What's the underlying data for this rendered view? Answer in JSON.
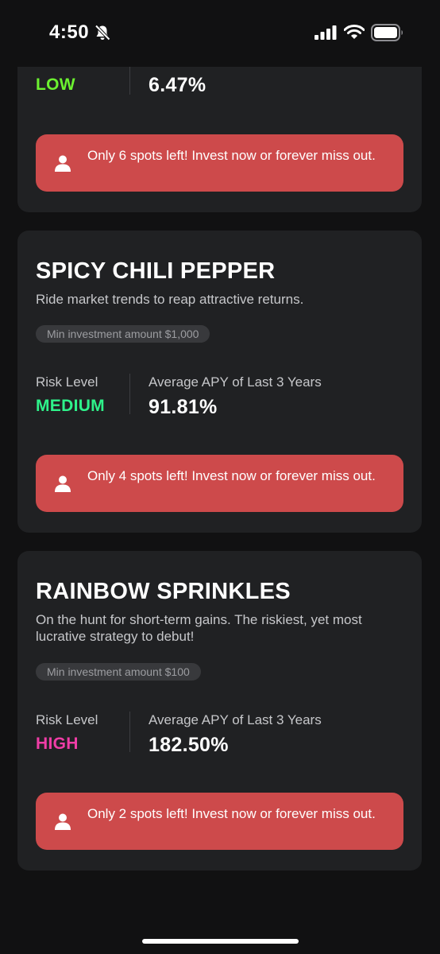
{
  "status_bar": {
    "time": "4:50"
  },
  "cards": [
    {
      "risk_value": "LOW",
      "risk_color": "#6cf230",
      "apy_value": "6.47%",
      "spots_text": "Only 6 spots left! Invest now or forever miss out."
    },
    {
      "title": "SPICY CHILI PEPPER",
      "description": "Ride market trends to reap attractive returns.",
      "min_investment": "Min investment amount $1,000",
      "risk_label": "Risk Level",
      "risk_value": "MEDIUM",
      "risk_color": "#2ef28a",
      "apy_label": "Average APY of Last 3 Years",
      "apy_value": "91.81%",
      "spots_text": "Only 4 spots left! Invest now or forever miss out."
    },
    {
      "title": "RAINBOW SPRINKLES",
      "description": "On the hunt for short-term gains. The riskiest, yet most lucrative strategy to debut!",
      "min_investment": "Min investment amount $100",
      "risk_label": "Risk Level",
      "risk_value": "HIGH",
      "risk_color": "#ef3da6",
      "apy_label": "Average APY of Last 3 Years",
      "apy_value": "182.50%",
      "spots_text": "Only 2 spots left! Invest now or forever miss out."
    }
  ],
  "colors": {
    "background": "#111112",
    "card": "#202123",
    "banner": "#cd4a4b"
  }
}
